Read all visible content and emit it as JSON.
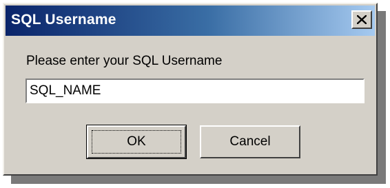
{
  "dialog": {
    "title": "SQL Username",
    "close_icon": "close-icon",
    "prompt": "Please enter your SQL Username",
    "username_value": "SQL_NAME",
    "ok_label": "OK",
    "cancel_label": "Cancel"
  },
  "colors": {
    "titlebar_start": "#0a246a",
    "titlebar_end": "#a6caf0",
    "face": "#d4d0c8"
  }
}
